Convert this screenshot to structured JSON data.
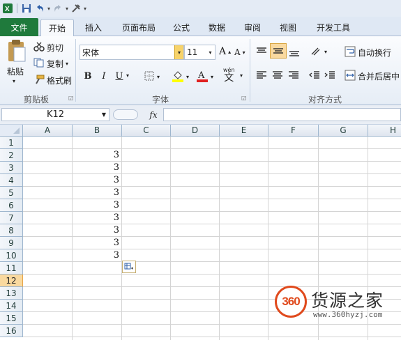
{
  "qat": {
    "icons": [
      "excel-logo-icon",
      "save-icon",
      "undo-icon",
      "redo-icon",
      "customize-icon"
    ]
  },
  "tabs": [
    "文件",
    "开始",
    "插入",
    "页面布局",
    "公式",
    "数据",
    "审阅",
    "视图",
    "开发工具"
  ],
  "ribbon": {
    "clipboard": {
      "paste": "粘贴",
      "cut": "剪切",
      "copy": "复制",
      "format_painter": "格式刷",
      "label": "剪贴板"
    },
    "font": {
      "name": "宋体",
      "size": "11",
      "label": "字体",
      "bold": "B",
      "italic": "I",
      "underline": "U",
      "grow": "A",
      "shrink": "A",
      "wen": "wén",
      "wen_char": "文"
    },
    "alignment": {
      "wrap": "自动换行",
      "merge": "合并后居中",
      "label": "对齐方式"
    }
  },
  "formula_bar": {
    "name_box": "K12",
    "fx": "fx",
    "value": ""
  },
  "grid": {
    "columns": [
      "A",
      "B",
      "C",
      "D",
      "E",
      "F",
      "G",
      "H"
    ],
    "rows": [
      "1",
      "2",
      "3",
      "4",
      "5",
      "6",
      "7",
      "8",
      "9",
      "10",
      "11",
      "12",
      "13",
      "14",
      "15",
      "16"
    ],
    "selected_row": "12",
    "column_b_values": [
      "",
      "3",
      "3",
      "3",
      "3",
      "3",
      "3",
      "3",
      "3",
      "3"
    ]
  },
  "watermark": {
    "logo": "360",
    "title": "货源之家",
    "url": "www.360hyzj.com"
  },
  "colors": {
    "file_tab": "#1f7a3c",
    "selected_row": "#f9d99f",
    "logo_red": "#e04a1d"
  }
}
